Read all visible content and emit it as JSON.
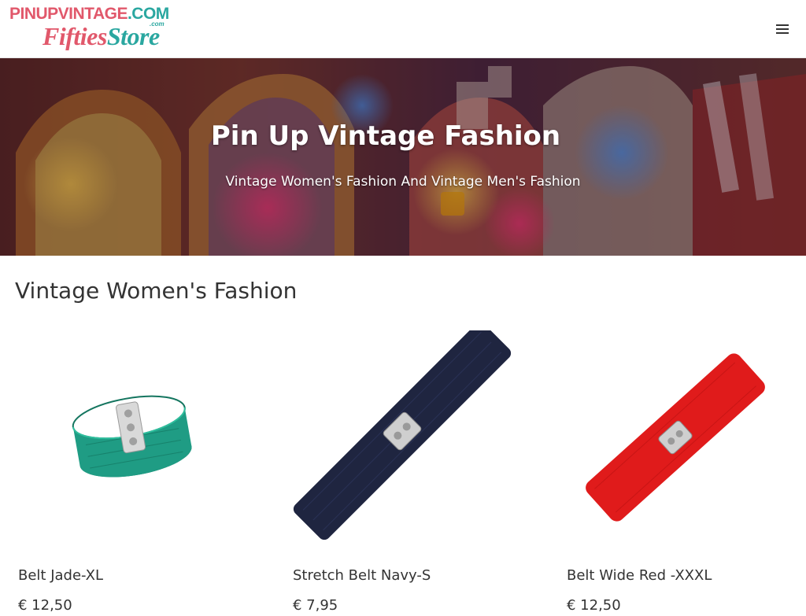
{
  "header": {
    "logo": {
      "line1_main": "PINUPVINTAGE",
      "line1_suffix": ".COM",
      "com_mark": ".com",
      "line2_part1": "Fifties",
      "line2_part2": "Store"
    },
    "menu_icon": "hamburger-menu-icon"
  },
  "hero": {
    "title": "Pin Up Vintage Fashion",
    "subtitle": "Vintage Women's Fashion And Vintage Men's Fashion"
  },
  "section": {
    "title": "Vintage Women's Fashion"
  },
  "products": [
    {
      "name": "Belt Jade-XL",
      "price": "€ 12,50",
      "color": "#1f9c84"
    },
    {
      "name": "Stretch Belt Navy-S",
      "price": "€ 7,95",
      "color": "#1f2540"
    },
    {
      "name": "Belt Wide Red -XXXL",
      "price": "€ 12,50",
      "color": "#e01b1b"
    }
  ],
  "colors": {
    "brand_pink": "#e1586b",
    "brand_teal": "#2aa7a0"
  }
}
